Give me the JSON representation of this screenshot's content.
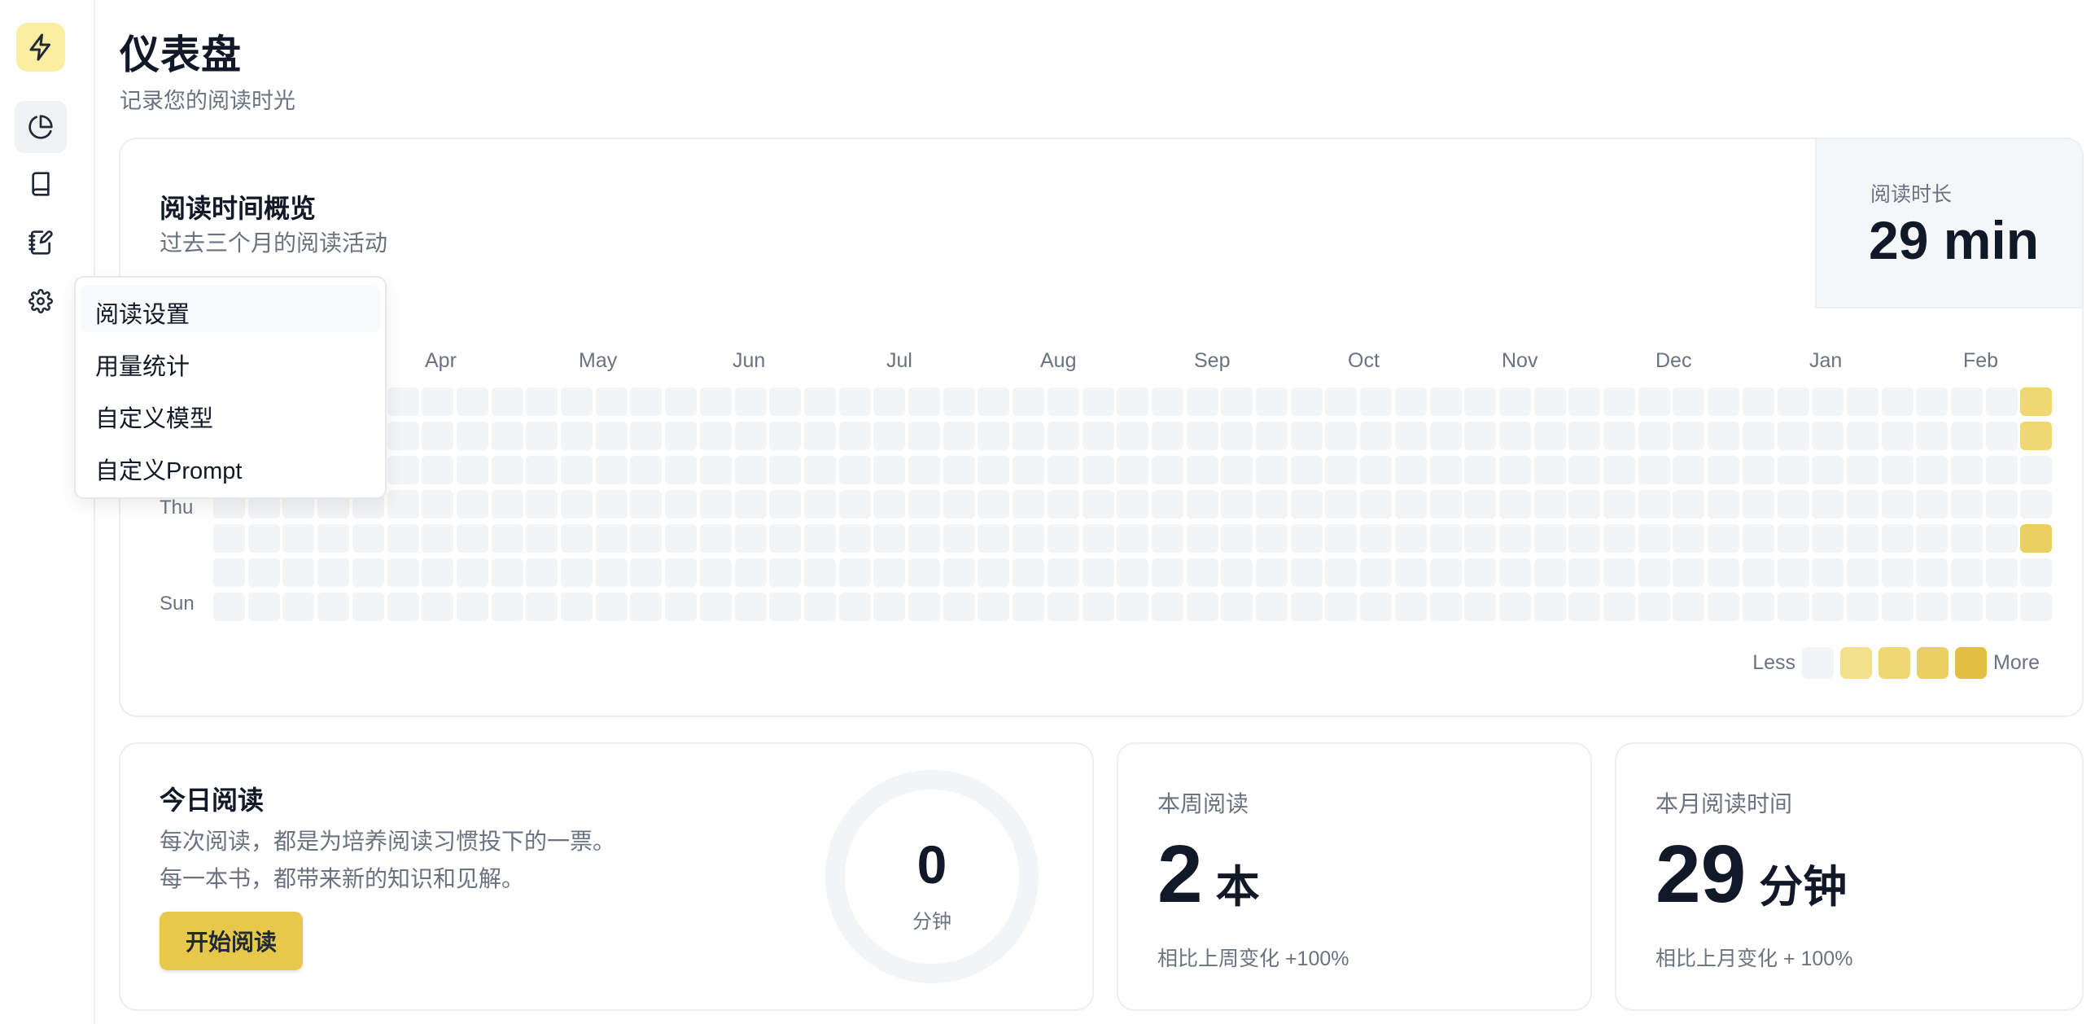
{
  "sidebar": {
    "logo_icon": "lightning-bolt-icon",
    "items": [
      {
        "icon": "pie-chart-icon",
        "active": true
      },
      {
        "icon": "book-icon",
        "active": false
      },
      {
        "icon": "notebook-pen-icon",
        "active": false
      },
      {
        "icon": "gear-icon",
        "active": false
      }
    ]
  },
  "header": {
    "title": "仪表盘",
    "subtitle": "记录您的阅读时光"
  },
  "overview": {
    "title": "阅读时间概览",
    "subtitle": "过去三个月的阅读活动",
    "stat_label": "阅读时长",
    "stat_value": "29 min",
    "months": [
      "Apr",
      "May",
      "Jun",
      "Jul",
      "Aug",
      "Sep",
      "Oct",
      "Nov",
      "Dec",
      "Jan",
      "Feb"
    ],
    "day_labels": [
      "Thu",
      "Sun"
    ],
    "legend_less": "Less",
    "legend_more": "More",
    "active_days": [
      {
        "row": 0,
        "level": 2
      },
      {
        "row": 1,
        "level": 2
      },
      {
        "row": 4,
        "level": 3
      }
    ]
  },
  "colors": {
    "accent": "#e8c84a",
    "empty_cell": "#f3f4f6",
    "levels": [
      "#f3f4f6",
      "#f4df8c",
      "#efd773",
      "#ead061",
      "#e3bf41"
    ],
    "logo_bg": "#fbeea0"
  },
  "today": {
    "title": "今日阅读",
    "line1": "每次阅读，都是为培养阅读习惯投下的一票。",
    "line2": "每一本书，都带来新的知识和见解。",
    "button": "开始阅读",
    "ring_value": "0",
    "ring_unit": "分钟"
  },
  "week": {
    "label": "本周阅读",
    "value": "2",
    "unit": "本",
    "note": "相比上周变化 +100%"
  },
  "month": {
    "label": "本月阅读时间",
    "value": "29",
    "unit": "分钟",
    "note": "相比上月变化 + 100%"
  },
  "menu": {
    "items": [
      "阅读设置",
      "用量统计",
      "自定义模型",
      "自定义Prompt"
    ]
  }
}
